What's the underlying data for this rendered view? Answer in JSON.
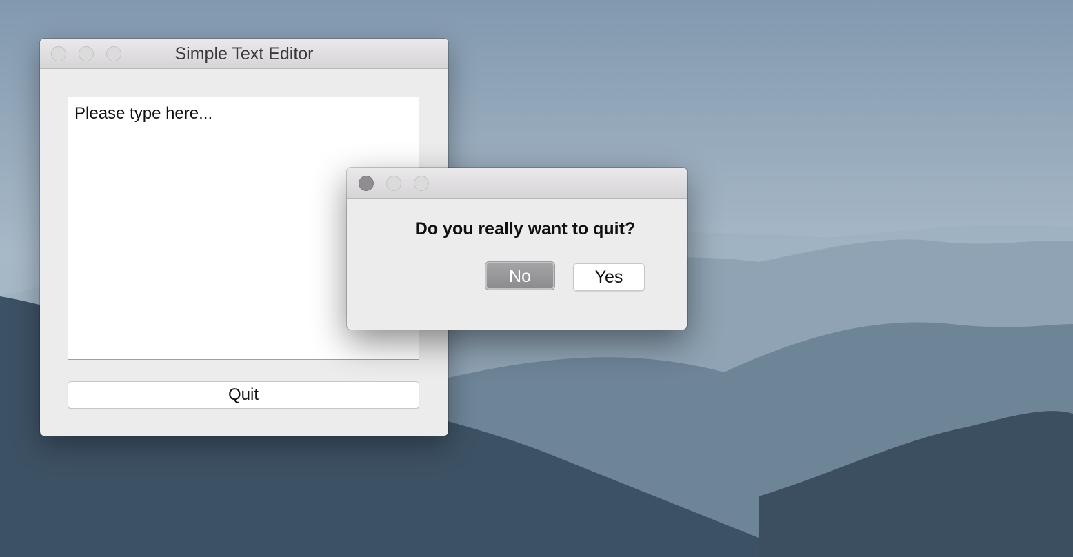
{
  "desktop": {
    "wallpaper": "misty-mountains"
  },
  "main_window": {
    "title": "Simple Text Editor",
    "editor_text": "Please type here...",
    "quit_label": "Quit"
  },
  "dialog": {
    "message": "Do you really want to quit?",
    "no_label": "No",
    "yes_label": "Yes"
  },
  "colors": {
    "dialog_default_button": "#8c8b8e",
    "window_background": "#ececec"
  }
}
